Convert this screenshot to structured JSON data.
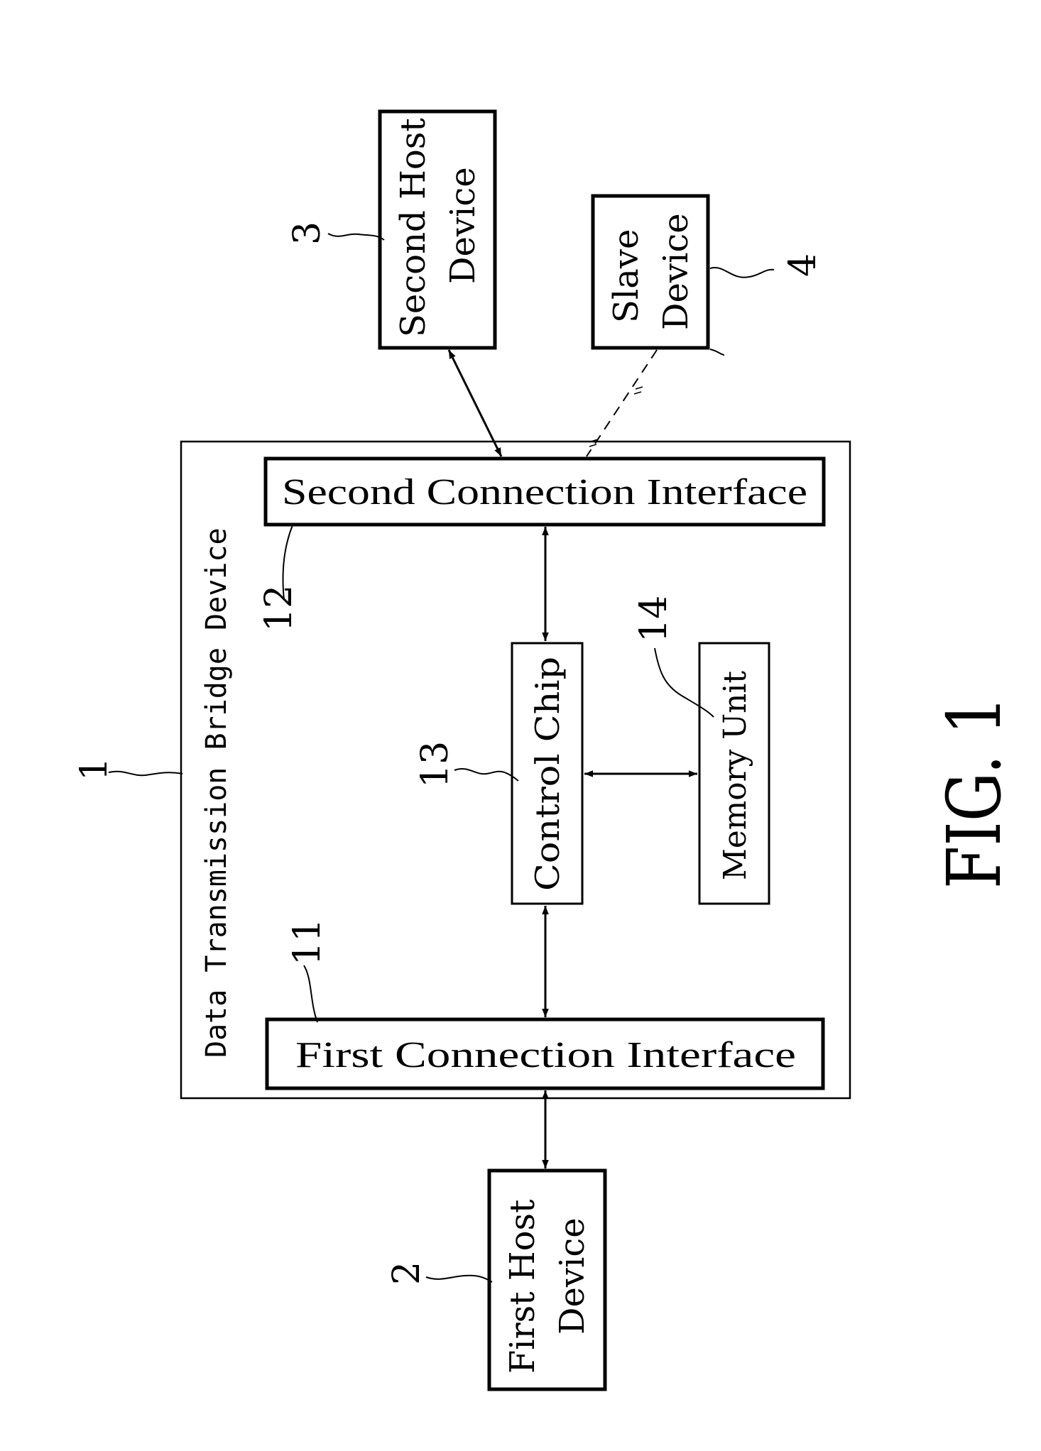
{
  "figure": {
    "caption": "FIG. 1",
    "nodes": {
      "bridge": {
        "ref": "1",
        "label": "Data Transmission Bridge Device"
      },
      "first_interface": {
        "ref": "11",
        "label": "First Connection Interface"
      },
      "second_interface": {
        "ref": "12",
        "label": "Second Connection Interface"
      },
      "control_chip": {
        "ref": "13",
        "label": "Control Chip"
      },
      "memory_unit": {
        "ref": "14",
        "label": "Memory Unit"
      },
      "first_host": {
        "ref": "2",
        "line1": "First Host",
        "line2": "Device"
      },
      "second_host": {
        "ref": "3",
        "line1": "Second Host",
        "line2": "Device"
      },
      "slave": {
        "ref": "4",
        "line1": "Slave",
        "line2": "Device"
      }
    },
    "connections": [
      {
        "from": "first_host",
        "to": "first_interface",
        "style": "solid",
        "direction": "bidirectional"
      },
      {
        "from": "first_interface",
        "to": "control_chip",
        "style": "solid",
        "direction": "bidirectional"
      },
      {
        "from": "control_chip",
        "to": "second_interface",
        "style": "solid",
        "direction": "bidirectional"
      },
      {
        "from": "control_chip",
        "to": "memory_unit",
        "style": "solid",
        "direction": "bidirectional"
      },
      {
        "from": "second_interface",
        "to": "second_host",
        "style": "solid",
        "direction": "bidirectional"
      },
      {
        "from": "second_interface",
        "to": "slave",
        "style": "dashed",
        "direction": "bidirectional"
      }
    ]
  }
}
